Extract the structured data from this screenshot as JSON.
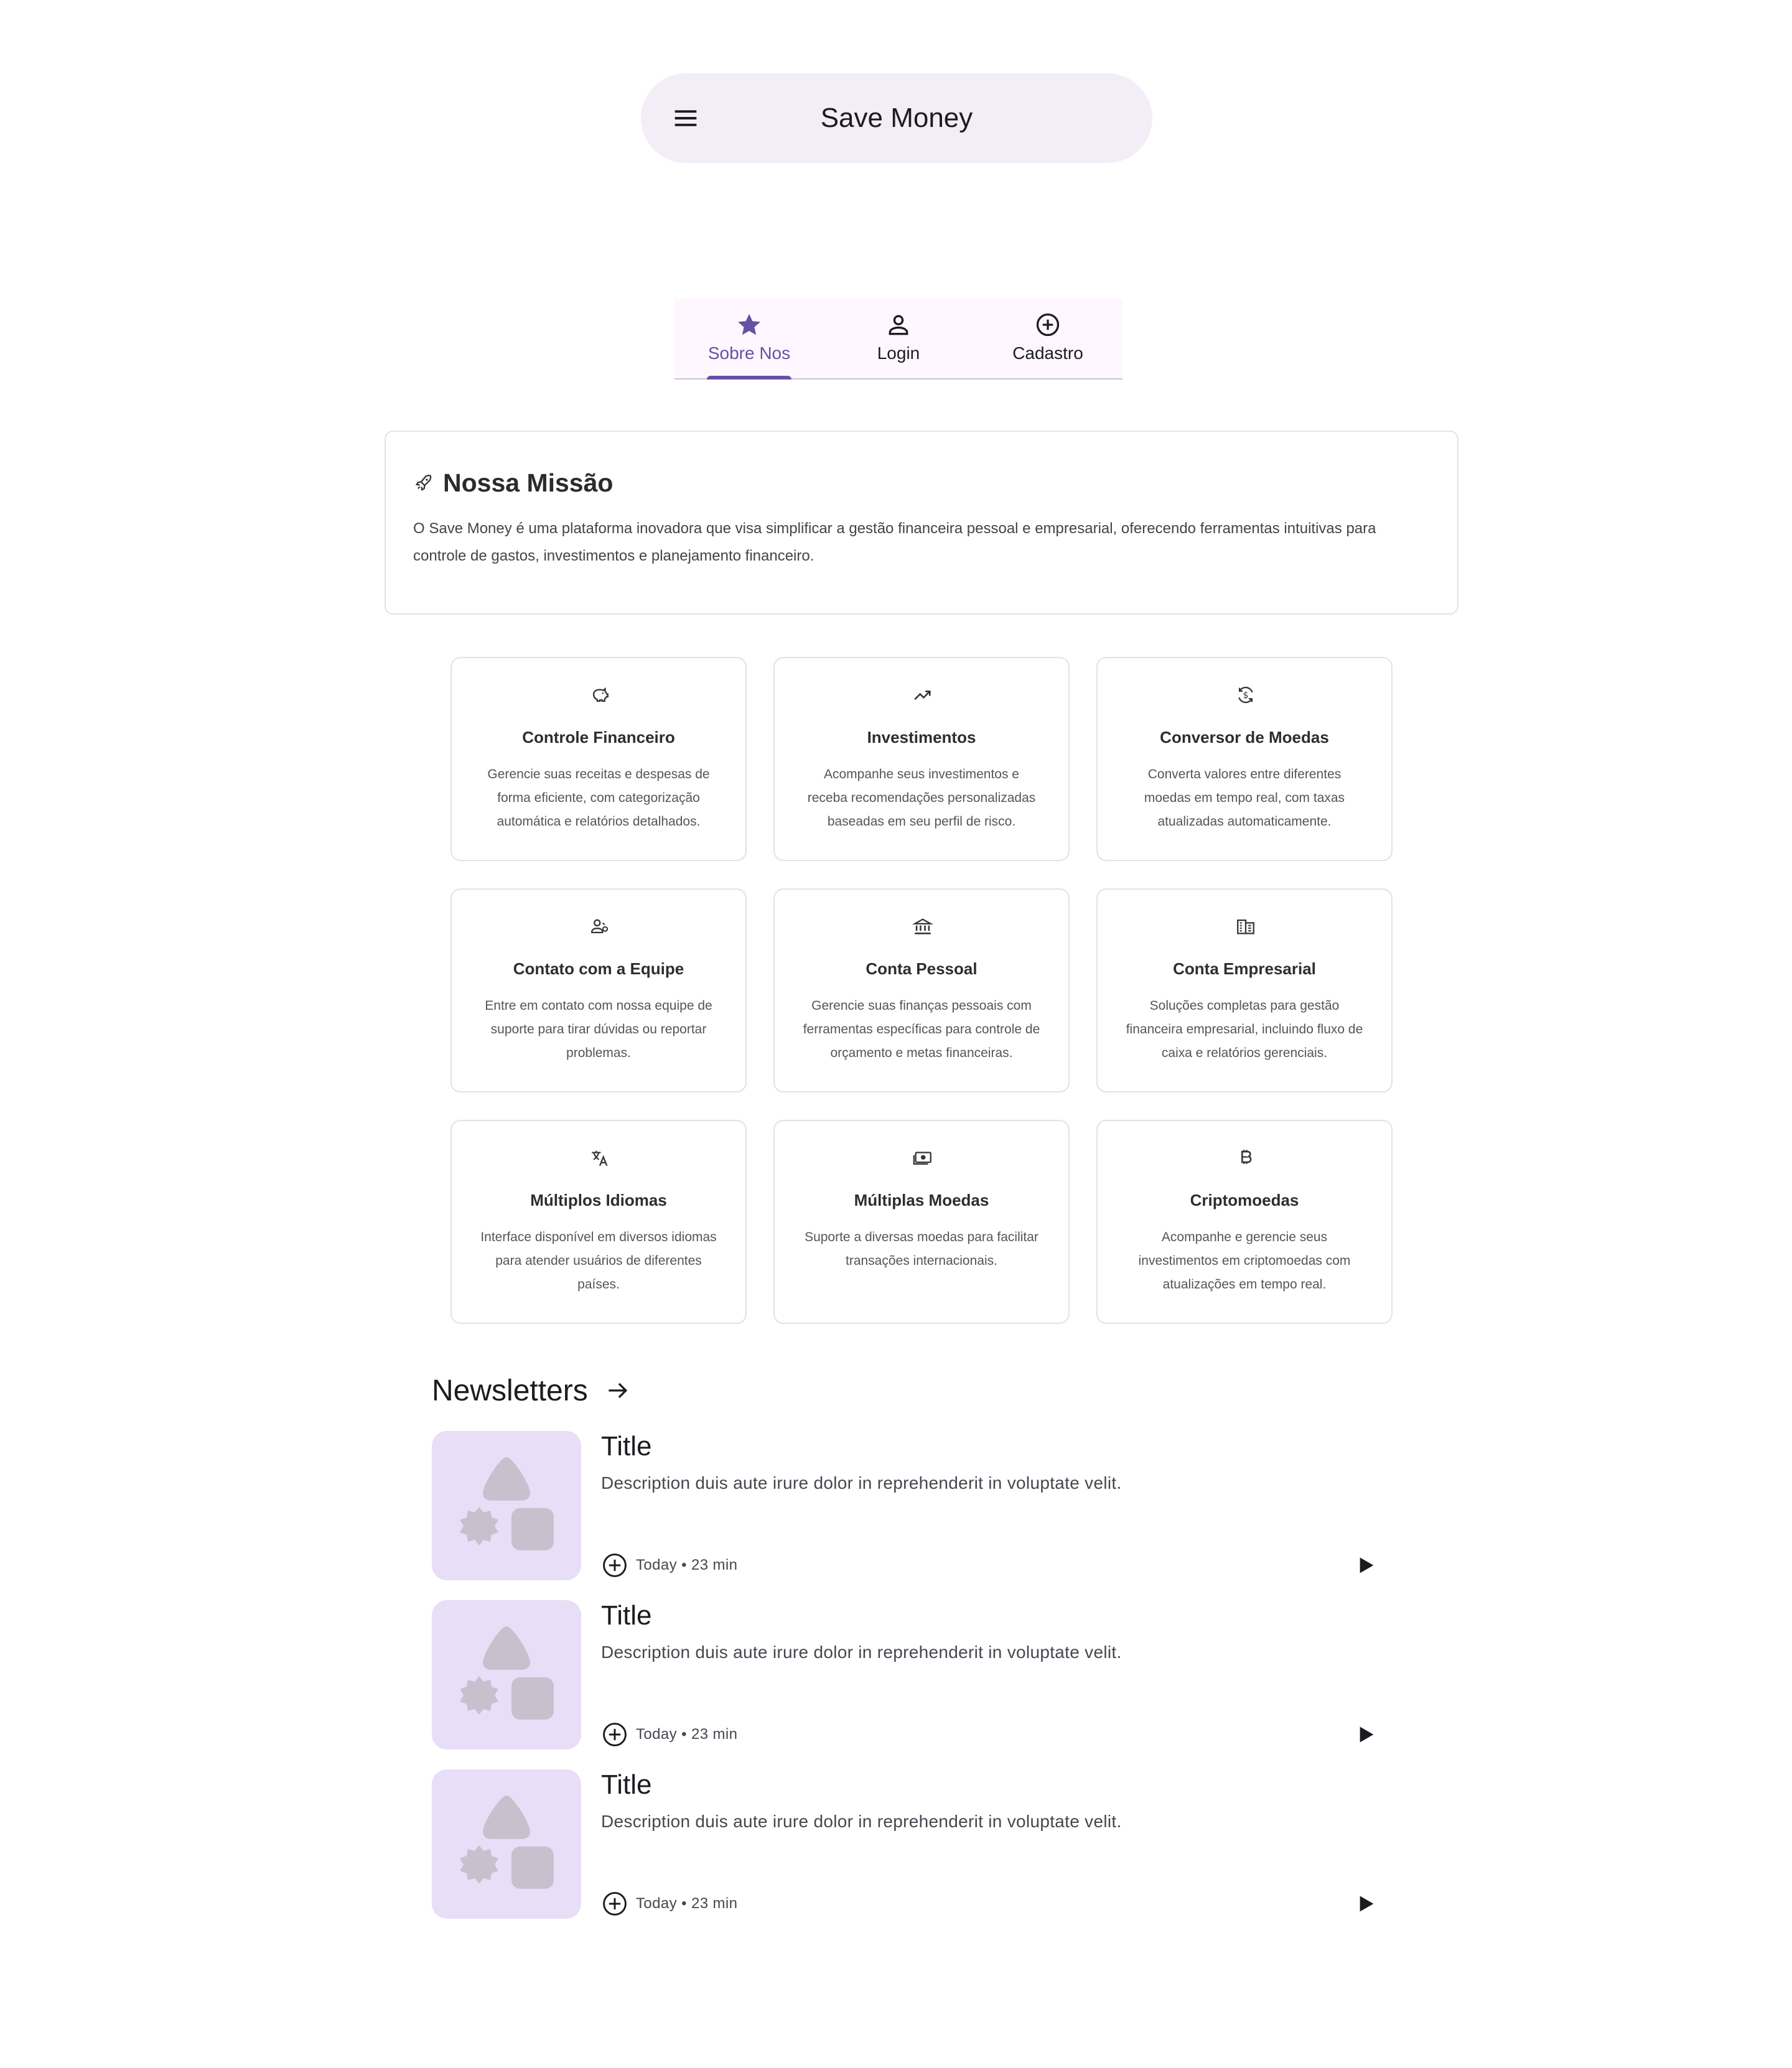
{
  "app_bar": {
    "title": "Save Money",
    "menu_icon": "menu-icon"
  },
  "tabs": [
    {
      "label": "Sobre Nos",
      "icon": "star-icon",
      "active": true
    },
    {
      "label": "Login",
      "icon": "person-icon",
      "active": false
    },
    {
      "label": "Cadastro",
      "icon": "add-circle-icon",
      "active": false
    }
  ],
  "mission": {
    "icon": "rocket-icon",
    "title": "Nossa Missão",
    "text": "O Save Money é uma plataforma inovadora que visa simplificar a gestão financeira pessoal e empresarial, oferecendo ferramentas intuitivas para controle de gastos, investimentos e planejamento financeiro."
  },
  "features": [
    {
      "icon": "piggy-bank-icon",
      "title": "Controle Financeiro",
      "description": "Gerencie suas receitas e despesas de forma eficiente, com categorização automática e relatórios detalhados."
    },
    {
      "icon": "trending-up-icon",
      "title": "Investimentos",
      "description": "Acompanhe seus investimentos e receba recomendações personalizadas baseadas em seu perfil de risco."
    },
    {
      "icon": "currency-exchange-icon",
      "title": "Conversor de Moedas",
      "description": "Converta valores entre diferentes moedas em tempo real, com taxas atualizadas automaticamente."
    },
    {
      "icon": "support-agent-icon",
      "title": "Contato com a Equipe",
      "description": "Entre em contato com nossa equipe de suporte para tirar dúvidas ou reportar problemas."
    },
    {
      "icon": "bank-icon",
      "title": "Conta Pessoal",
      "description": "Gerencie suas finanças pessoais com ferramentas específicas para controle de orçamento e metas financeiras."
    },
    {
      "icon": "business-icon",
      "title": "Conta Empresarial",
      "description": "Soluções completas para gestão financeira empresarial, incluindo fluxo de caixa e relatórios gerenciais."
    },
    {
      "icon": "translate-icon",
      "title": "Múltiplos Idiomas",
      "description": "Interface disponível em diversos idiomas para atender usuários de diferentes países."
    },
    {
      "icon": "money-icon",
      "title": "Múltiplas Moedas",
      "description": "Suporte a diversas moedas para facilitar transações internacionais."
    },
    {
      "icon": "bitcoin-icon",
      "title": "Criptomoedas",
      "description": "Acompanhe e gerencie seus investimentos em criptomoedas com atualizações em tempo real."
    }
  ],
  "newsletters": {
    "title": "Newsletters",
    "arrow_icon": "arrow-forward-icon",
    "items": [
      {
        "title": "Title",
        "description": "Description duis aute irure dolor in reprehenderit in voluptate velit.",
        "meta": "Today • 23 min"
      },
      {
        "title": "Title",
        "description": "Description duis aute irure dolor in reprehenderit in voluptate velit.",
        "meta": "Today • 23 min"
      },
      {
        "title": "Title",
        "description": "Description duis aute irure dolor in reprehenderit in voluptate velit.",
        "meta": "Today • 23 min"
      }
    ]
  },
  "colors": {
    "primary": "#6750a4",
    "surface_container": "#f3edf7",
    "thumb_bg": "#e8def8",
    "thumb_shape": "#c9c0cd"
  }
}
